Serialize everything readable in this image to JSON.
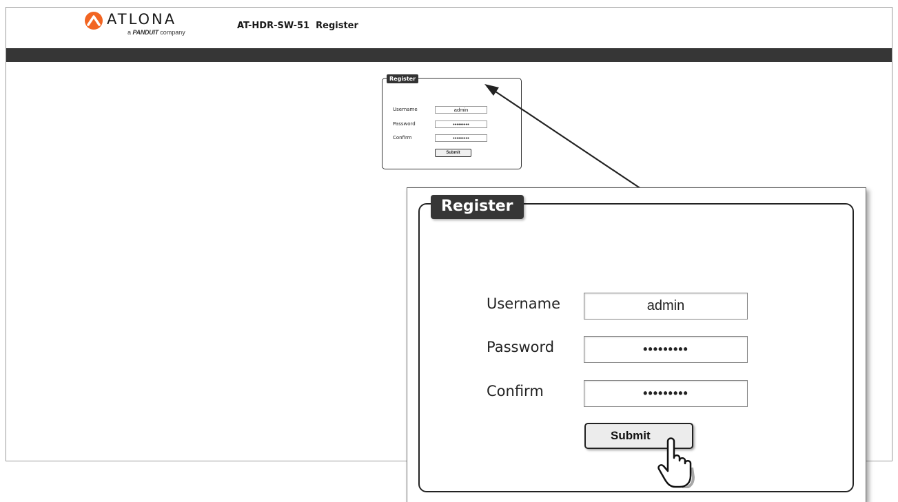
{
  "header": {
    "logo_word": "ATLONA",
    "logo_tag_prefix": "a",
    "logo_tag_brand": "PANDUIT",
    "logo_tag_suffix": "company",
    "title": "AT-HDR-SW-51  Register",
    "logo_orange": "#f26522"
  },
  "register_small": {
    "legend": "Register",
    "username_label": "Username",
    "username_value": "admin",
    "password_label": "Password",
    "password_value": "•••••••••",
    "confirm_label": "Confirm",
    "confirm_value": "•••••••••",
    "submit_label": "Submit"
  },
  "register_zoom": {
    "legend": "Register",
    "username_label": "Username",
    "username_value": "admin",
    "password_label": "Password",
    "password_value": "•••••••••",
    "confirm_label": "Confirm",
    "confirm_value": "•••••••••",
    "submit_label": "Submit"
  },
  "colors": {
    "nav_bar": "#363636",
    "legend_bg": "#363636"
  },
  "icons": {
    "cursor": "hand-pointer-icon",
    "callout": "arrow-icon"
  }
}
